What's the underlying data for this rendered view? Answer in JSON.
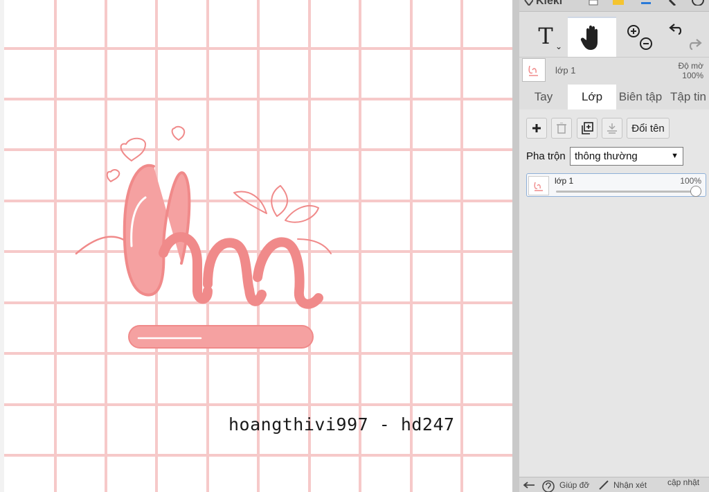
{
  "app": {
    "name": "Kleki"
  },
  "canvas": {
    "grid_color": "#f6c9c9",
    "ink_color": "#f08a8a",
    "watermark": "hoangthivi997 - hd247"
  },
  "toolbar": {
    "text_tool_icon": "T",
    "text_dropdown_icon": "⌄"
  },
  "layer_info": {
    "name": "lớp 1",
    "opacity_label": "Độ mờ",
    "opacity_value": "100%"
  },
  "tabs": [
    {
      "label": "Tay"
    },
    {
      "label": "Lớp"
    },
    {
      "label": "Biên tập"
    },
    {
      "label": "Tập tin"
    }
  ],
  "layers_tab": {
    "rename_label": "Đổi tên",
    "blend_label": "Pha trộn",
    "blend_value": "thông thường",
    "layers": [
      {
        "name": "lớp 1",
        "opacity": "100%",
        "opacity_fraction": 1.0
      }
    ]
  },
  "bottom_bar": {
    "help_label": "Giúp đỡ",
    "feedback_label": "Nhận xét",
    "update_label": "cập nhật"
  }
}
